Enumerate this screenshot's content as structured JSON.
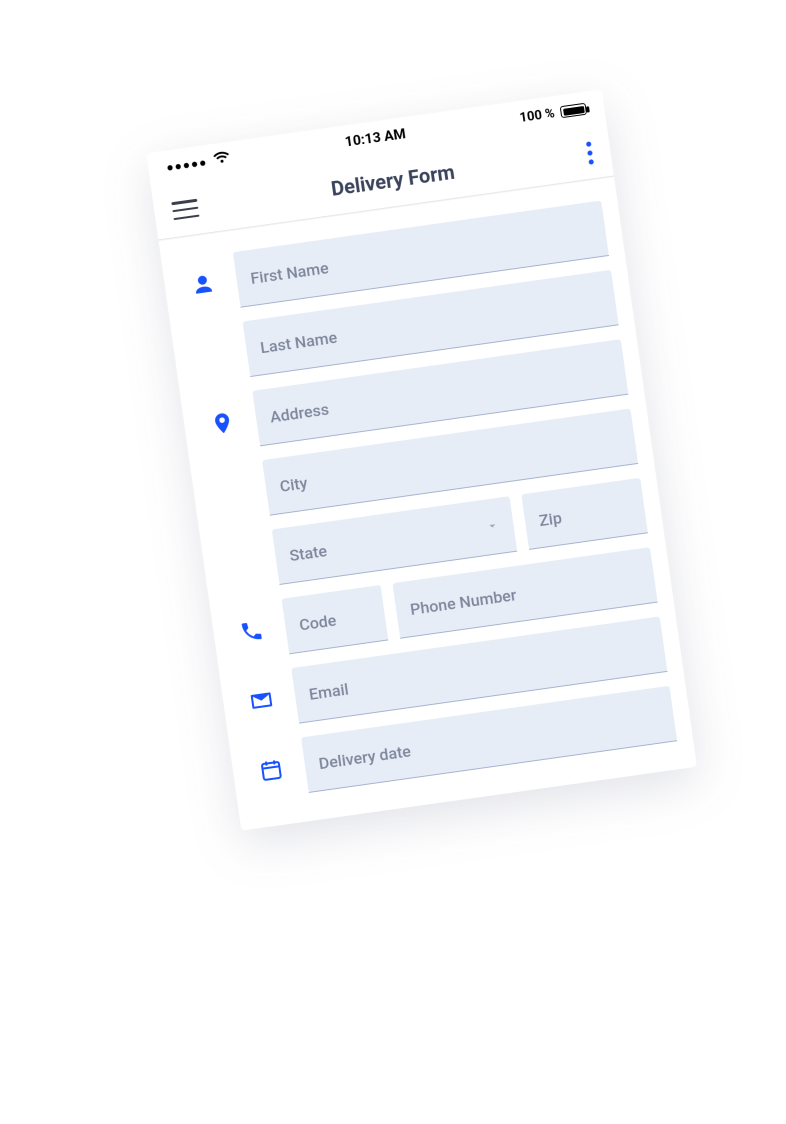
{
  "status_bar": {
    "signal_dots": "●●●●●",
    "time": "10:13 AM",
    "battery_text": "100 %"
  },
  "nav": {
    "title": "Delivery Form"
  },
  "form": {
    "first_name": {
      "placeholder": "First Name"
    },
    "last_name": {
      "placeholder": "Last Name"
    },
    "address": {
      "placeholder": "Address"
    },
    "city": {
      "placeholder": "City"
    },
    "state": {
      "placeholder": "State"
    },
    "zip": {
      "placeholder": "Zip"
    },
    "code": {
      "placeholder": "Code"
    },
    "phone": {
      "placeholder": "Phone Number"
    },
    "email": {
      "placeholder": "Email"
    },
    "delivery_date": {
      "placeholder": "Delivery date"
    }
  }
}
